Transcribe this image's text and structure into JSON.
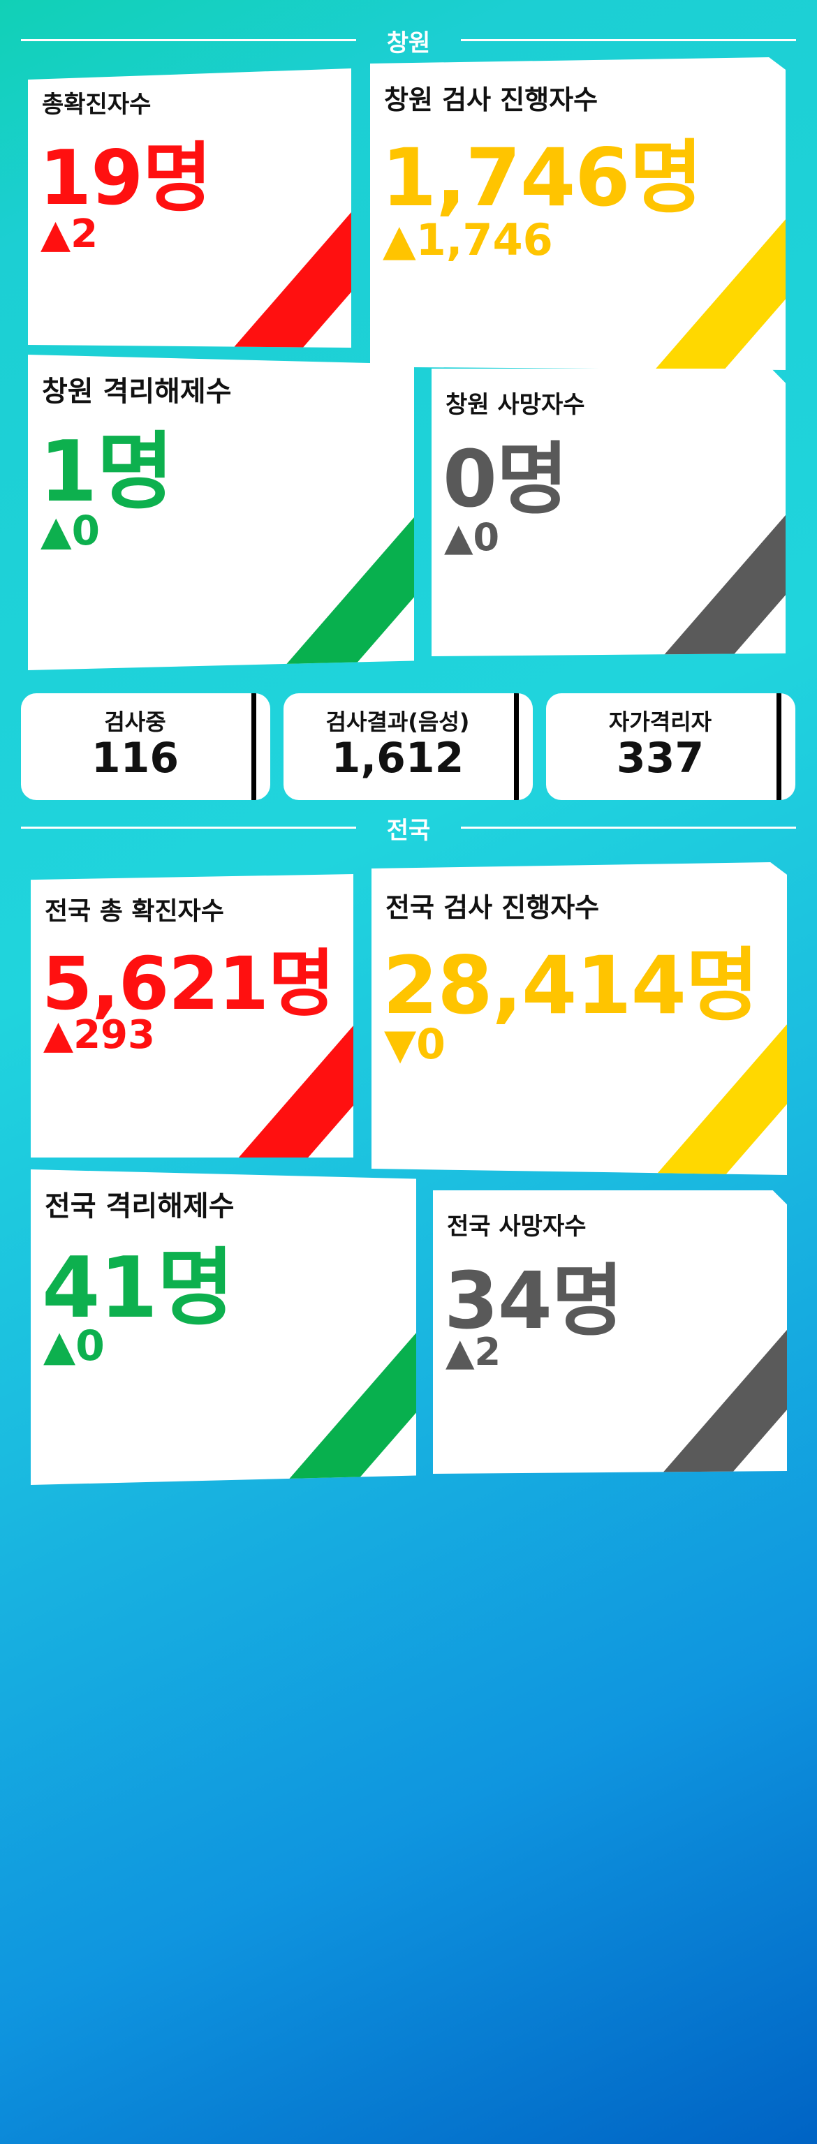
{
  "changwon": {
    "title": "창원",
    "total": {
      "label": "총확진자수",
      "value": "19명",
      "delta": "▲2"
    },
    "testing": {
      "label": "창원 검사 진행자수",
      "value": "1,746명",
      "delta": "▲1,746"
    },
    "released": {
      "label": "창원 격리해제수",
      "value": "1명",
      "delta": "▲0"
    },
    "deaths": {
      "label": "창원 사망자수",
      "value": "0명",
      "delta": "▲0"
    }
  },
  "summary": [
    {
      "label": "검사중",
      "value": "116"
    },
    {
      "label": "검사결과(음성)",
      "value": "1,612"
    },
    {
      "label": "자가격리자",
      "value": "337"
    }
  ],
  "national": {
    "title": "전국",
    "total": {
      "label": "전국 총 확진자수",
      "value": "5,621명",
      "delta": "▲293"
    },
    "testing": {
      "label": "전국 검사 진행자수",
      "value": "28,414명",
      "delta": "▼0"
    },
    "released": {
      "label": "전국 격리해제수",
      "value": "41명",
      "delta": "▲0"
    },
    "deaths": {
      "label": "전국 사망자수",
      "value": "34명",
      "delta": "▲2"
    }
  },
  "colors": {
    "red": "#ff1010",
    "yellow": "#ffd800",
    "green": "#08b04e",
    "gray": "#5a5a5a",
    "divider": "#000000"
  }
}
